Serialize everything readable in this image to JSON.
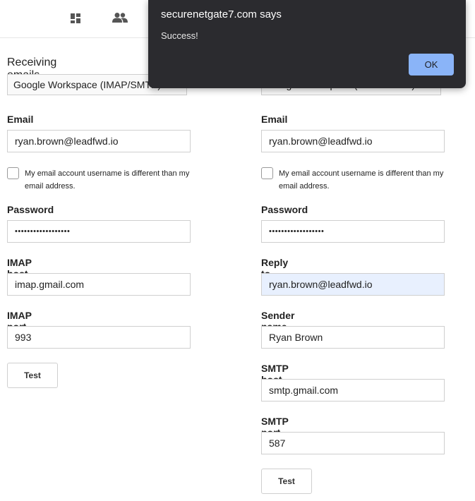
{
  "topbar": {
    "icons": [
      "dashboard-icon",
      "users-icon"
    ]
  },
  "receiving": {
    "title": "Receiving emails",
    "provider": "Google Workspace (IMAP/SMTP)",
    "email_label": "Email",
    "email_value": "ryan.brown@leadfwd.io",
    "username_diff_label": "My email account username is different than my email address.",
    "password_label": "Password",
    "password_value": "••••••••••••••••••",
    "host_label": "IMAP host",
    "host_value": "imap.gmail.com",
    "port_label": "IMAP port",
    "port_value": "993",
    "test_label": "Test"
  },
  "sending": {
    "provider": "Google Workspace (IMAP/SMTP)",
    "email_label": "Email",
    "email_value": "ryan.brown@leadfwd.io",
    "username_diff_label": "My email account username is different than my email address.",
    "password_label": "Password",
    "password_value": "••••••••••••••••••",
    "reply_to_label": "Reply to",
    "reply_to_value": "ryan.brown@leadfwd.io",
    "sender_name_label": "Sender name",
    "sender_name_value": "Ryan Brown",
    "host_label": "SMTP host",
    "host_value": "smtp.gmail.com",
    "port_label": "SMTP port",
    "port_value": "587",
    "test_label": "Test"
  },
  "dialog": {
    "title": "securenetgate7.com says",
    "message": "Success!",
    "ok_label": "OK",
    "accent_color": "#8ab4f8",
    "background_color": "#2b2b2f"
  }
}
